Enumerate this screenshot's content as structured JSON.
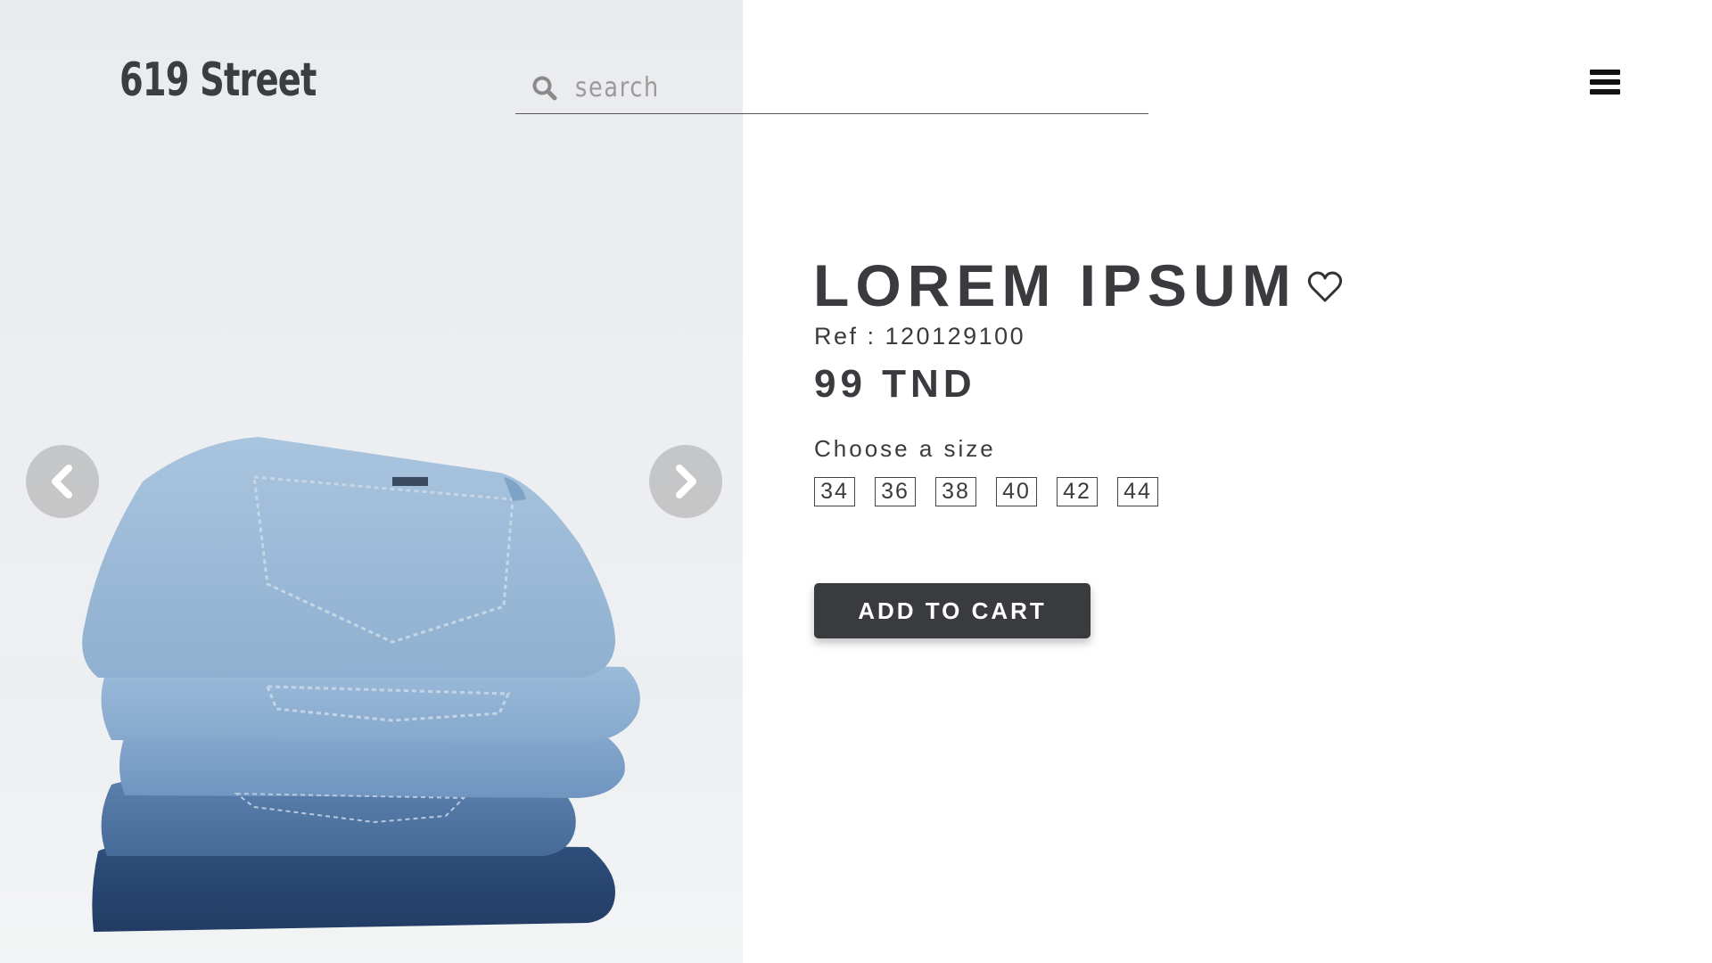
{
  "header": {
    "logo": "619 Street",
    "search_placeholder": "search"
  },
  "product": {
    "title": "LOREM IPSUM",
    "ref": "Ref : 120129100",
    "price": "99 TND",
    "size_label": "Choose a size",
    "sizes": [
      "34",
      "36",
      "38",
      "40",
      "42",
      "44"
    ],
    "add_to_cart": "ADD TO CART"
  },
  "icons": {
    "search": "search-icon",
    "menu": "hamburger-menu-icon",
    "wishlist": "heart-icon",
    "prev": "chevron-left-icon",
    "next": "chevron-right-icon"
  },
  "colors": {
    "primary_dark": "#3a3b3f",
    "image_background": "#eceef1"
  }
}
